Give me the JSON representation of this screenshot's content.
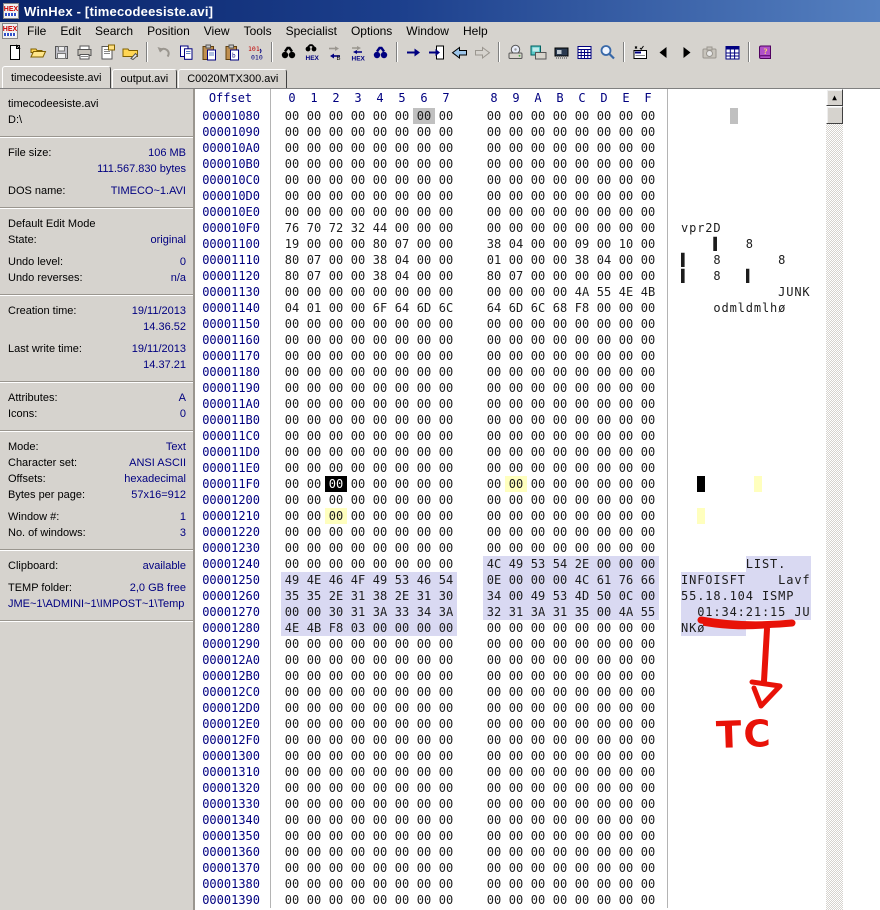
{
  "window": {
    "title": "WinHex - [timecodeesiste.avi]"
  },
  "menu": {
    "items": [
      "File",
      "Edit",
      "Search",
      "Position",
      "View",
      "Tools",
      "Specialist",
      "Options",
      "Window",
      "Help"
    ]
  },
  "toolbar": {
    "groups": [
      [
        "new-document",
        "open-folder",
        "save",
        "print",
        "properties",
        "folder-edit"
      ],
      [
        "undo",
        "copy",
        "paste",
        "paste-special",
        "binary-convert"
      ],
      [
        "find",
        "find-hex",
        "replace",
        "replace-hex",
        "find-next"
      ],
      [
        "goto-offset",
        "goto-page",
        "back",
        "forward"
      ],
      [
        "disk-tools",
        "drives",
        "ram",
        "calculator",
        "magnifier"
      ],
      [
        "options-check",
        "prev-window",
        "next-window",
        "camera",
        "data-grid"
      ],
      [
        "help-book"
      ]
    ]
  },
  "tabs": [
    {
      "label": "timecodeesiste.avi",
      "active": true
    },
    {
      "label": "output.avi",
      "active": false
    },
    {
      "label": "C0020MTX300.avi",
      "active": false
    }
  ],
  "sidebar": {
    "sections": [
      [
        {
          "l": "timecodeesiste.avi"
        },
        {
          "l": "D:\\"
        }
      ],
      [
        {
          "l": "File size:",
          "v": "106 MB"
        },
        {
          "v": "111.567.830 bytes"
        },
        {
          "g": 1
        },
        {
          "l": "DOS name:",
          "v": "TIMECO~1.AVI"
        }
      ],
      [
        {
          "l": "Default Edit Mode"
        },
        {
          "l": "State:",
          "v": "original"
        },
        {
          "g": 1
        },
        {
          "l": "Undo level:",
          "v": "0"
        },
        {
          "l": "Undo reverses:",
          "v": "n/a"
        }
      ],
      [
        {
          "l": "Creation time:",
          "v": "19/11/2013"
        },
        {
          "v": "14.36.52"
        },
        {
          "g": 1
        },
        {
          "l": "Last write time:",
          "v": "19/11/2013"
        },
        {
          "v": "14.37.21"
        }
      ],
      [
        {
          "l": "Attributes:",
          "v": "A"
        },
        {
          "l": "Icons:",
          "v": "0"
        }
      ],
      [
        {
          "l": "Mode:",
          "v": "Text"
        },
        {
          "l": "Character set:",
          "v": "ANSI ASCII"
        },
        {
          "l": "Offsets:",
          "v": "hexadecimal"
        },
        {
          "l": "Bytes per page:",
          "v": "57x16=912"
        },
        {
          "g": 1
        },
        {
          "l": "Window #:",
          "v": "1"
        },
        {
          "l": "No. of windows:",
          "v": "3"
        }
      ],
      [
        {
          "l": "Clipboard:",
          "v": "available"
        },
        {
          "g": 1
        },
        {
          "l": "TEMP folder:",
          "v": "2,0 GB free"
        },
        {
          "p": "JME~1\\ADMINI~1\\IMPOST~1\\Temp"
        }
      ]
    ]
  },
  "hex_view": {
    "offset_label": "Offset",
    "columns": [
      "0",
      "1",
      "2",
      "3",
      "4",
      "5",
      "6",
      "7",
      "8",
      "9",
      "A",
      "B",
      "C",
      "D",
      "E",
      "F"
    ],
    "fill_row": "00 00 00 00 00 00 00 00 00 00 00 00 00 00 00 00",
    "rows": [
      {
        "o": "00001080",
        "m": [
          [
            6,
            6,
            "g"
          ]
        ]
      },
      {
        "o": "00001090"
      },
      {
        "o": "000010A0"
      },
      {
        "o": "000010B0"
      },
      {
        "o": "000010C0"
      },
      {
        "o": "000010D0"
      },
      {
        "o": "000010E0"
      },
      {
        "o": "000010F0",
        "b": "76 70 72 32 44 00 00 00 00 00 00 00 00 00 00 00",
        "a": "vpr2D"
      },
      {
        "o": "00001100",
        "b": "19 00 00 00 80 07 00 00 38 04 00 00 09 00 10 00",
        "a": "    ▌   8"
      },
      {
        "o": "00001110",
        "b": "80 07 00 00 38 04 00 00 01 00 00 00 38 04 00 00",
        "a": "▌   8       8"
      },
      {
        "o": "00001120",
        "b": "80 07 00 00 38 04 00 00 80 07 00 00 00 00 00 00",
        "a": "▌   8   ▌"
      },
      {
        "o": "00001130",
        "b": "00 00 00 00 00 00 00 00 00 00 00 00 4A 55 4E 4B",
        "a": "            JUNK"
      },
      {
        "o": "00001140",
        "b": "04 01 00 00 6F 64 6D 6C 64 6D 6C 68 F8 00 00 00",
        "a": "    odmldmlhø"
      },
      {
        "o": "00001150"
      },
      {
        "o": "00001160"
      },
      {
        "o": "00001170"
      },
      {
        "o": "00001180"
      },
      {
        "o": "00001190"
      },
      {
        "o": "000011A0"
      },
      {
        "o": "000011B0"
      },
      {
        "o": "000011C0"
      },
      {
        "o": "000011D0"
      },
      {
        "o": "000011E0"
      },
      {
        "o": "000011F0",
        "m": [
          [
            2,
            2,
            "k"
          ],
          [
            9,
            9,
            "y"
          ]
        ]
      },
      {
        "o": "00001200"
      },
      {
        "o": "00001210",
        "m": [
          [
            2,
            2,
            "y"
          ]
        ]
      },
      {
        "o": "00001220"
      },
      {
        "o": "00001230"
      },
      {
        "o": "00001240",
        "b": "00 00 00 00 00 00 00 00 4C 49 53 54 2E 00 00 00",
        "a": "        LIST.",
        "m": [
          [
            8,
            15,
            "s"
          ]
        ]
      },
      {
        "o": "00001250",
        "b": "49 4E 46 4F 49 53 46 54 0E 00 00 00 4C 61 76 66",
        "a": "INFOISFT    Lavf",
        "m": [
          [
            0,
            15,
            "s"
          ]
        ]
      },
      {
        "o": "00001260",
        "b": "35 35 2E 31 38 2E 31 30 34 00 49 53 4D 50 0C 00",
        "a": "55.18.104 ISMP",
        "m": [
          [
            0,
            15,
            "s"
          ]
        ]
      },
      {
        "o": "00001270",
        "b": "00 00 30 31 3A 33 34 3A 32 31 3A 31 35 00 4A 55",
        "a": "  01:34:21:15 JU",
        "m": [
          [
            0,
            15,
            "s"
          ]
        ]
      },
      {
        "o": "00001280",
        "b": "4E 4B F8 03 00 00 00 00 00 00 00 00 00 00 00 00",
        "a": "NKø",
        "m": [
          [
            0,
            7,
            "s"
          ]
        ]
      },
      {
        "o": "00001290"
      },
      {
        "o": "000012A0"
      },
      {
        "o": "000012B0"
      },
      {
        "o": "000012C0"
      },
      {
        "o": "000012D0"
      },
      {
        "o": "000012E0"
      },
      {
        "o": "000012F0"
      },
      {
        "o": "00001300"
      },
      {
        "o": "00001310"
      },
      {
        "o": "00001320"
      },
      {
        "o": "00001330"
      },
      {
        "o": "00001340"
      },
      {
        "o": "00001350"
      },
      {
        "o": "00001360"
      },
      {
        "o": "00001370"
      },
      {
        "o": "00001380"
      },
      {
        "o": "00001390"
      }
    ]
  },
  "scrollbar": {
    "up_glyph": "▲"
  },
  "annotation": {
    "label": "TC",
    "color": "#e81208"
  }
}
